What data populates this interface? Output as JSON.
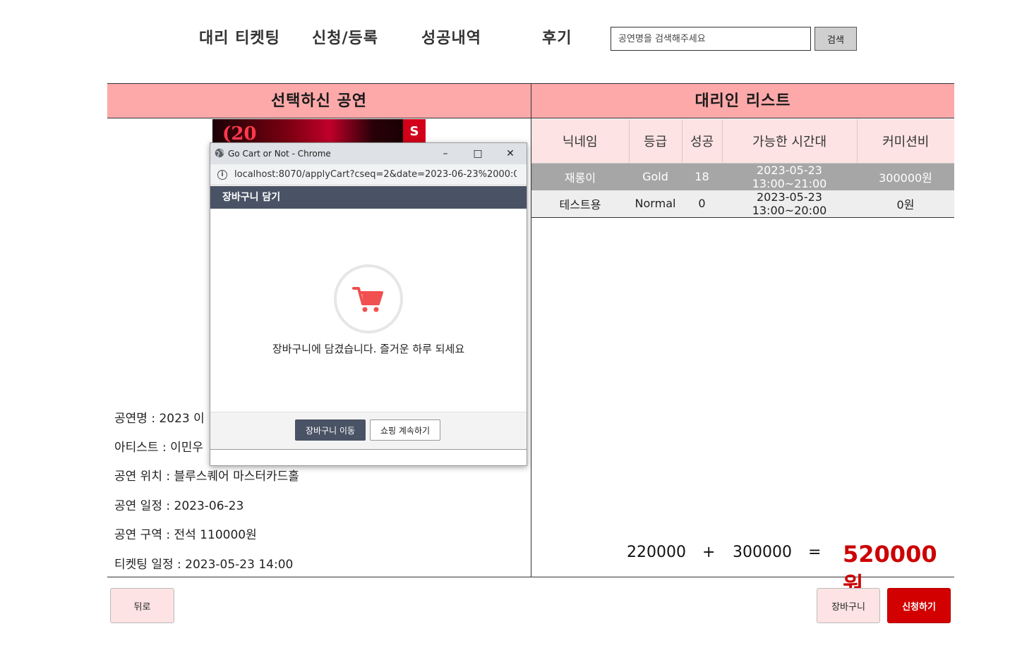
{
  "nav": {
    "items": [
      "대리 티켓팅",
      "신청/등록",
      "성공내역",
      "후기"
    ],
    "search_placeholder": "공연명을 검색해주세요",
    "search_button": "검색"
  },
  "left": {
    "title": "선택하신 공연",
    "poster_text": "20",
    "poster_band": "S",
    "info": [
      "공연명 : 2023 이",
      "아티스트 : 이민우",
      "공연 위치 : 블루스퀘어 마스터카드홀",
      "공연 일정 : 2023-06-23",
      "공연 구역 : 전석 110000원",
      "티켓팅 일정 : 2023-05-23 14:00"
    ]
  },
  "right": {
    "title": "대리인 리스트",
    "columns": [
      "닉네임",
      "등급",
      "성공",
      "가능한 시간대",
      "커미션비"
    ],
    "rows": [
      [
        "재롱이",
        "Gold",
        "18",
        "2023-05-23 13:00~21:00",
        "300000원"
      ],
      [
        "테스트용",
        "Normal",
        "0",
        "2023-05-23 13:00~20:00",
        "0원"
      ]
    ]
  },
  "totals": {
    "ticket": "220000",
    "plus": "+",
    "commission": "300000",
    "equals": "=",
    "grand": "520000원"
  },
  "buttons": {
    "back": "뒤로",
    "cart": "장바구니",
    "apply": "신청하기"
  },
  "popup": {
    "window_title": "Go Cart or Not - Chrome",
    "url": "localhost:8070/applyCart?cseq=2&date=2023-06-23%2000:0...",
    "header": "장바구니 담기",
    "message": "장바구니에 담겼습니다. 즐거운 하루 되세요",
    "go_cart": "장바구니 이동",
    "continue": "쇼핑 계속하기",
    "accent": "#4a5365",
    "icon_color": "#f05050"
  },
  "colors": {
    "header_bg": "#fda9a9",
    "table_head_bg": "#fde3e3",
    "selected_row": "#a6a6a6",
    "grand_total": "#cc0000",
    "apply_button": "#d30000"
  }
}
